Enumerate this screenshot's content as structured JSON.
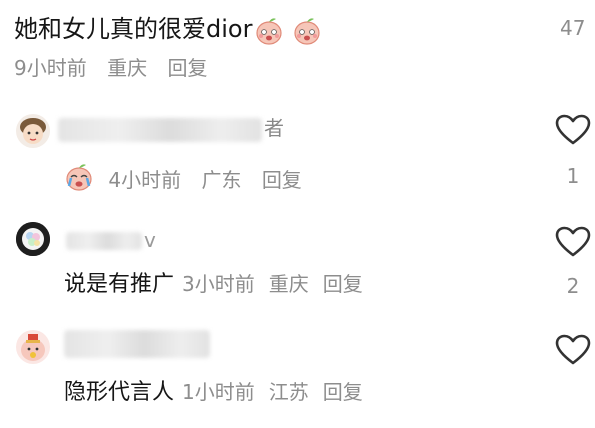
{
  "top_comment": {
    "text": "她和女儿真的很爱dior",
    "emoji": "peach-face-emoji",
    "time": "9小时前",
    "location": "重庆",
    "reply_label": "回复",
    "likes": "47"
  },
  "comments": [
    {
      "username_visible": "者",
      "reply": {
        "emoji": "crying-face-emoji",
        "time": "4小时前",
        "location": "广东",
        "reply_label": "回复"
      },
      "likes": "1"
    },
    {
      "username_visible": "v",
      "text": "说是有推广",
      "time": "3小时前",
      "location": "重庆",
      "reply_label": "回复",
      "likes": "2"
    },
    {
      "text": "隐形代言人",
      "time": "1小时前",
      "location": "江苏",
      "reply_label": "回复"
    }
  ],
  "colors": {
    "text": "#161616",
    "meta": "#8d8d8d",
    "heart": "#333333"
  },
  "icons": [
    "heart-outline-icon",
    "peach-face-emoji",
    "crying-face-emoji"
  ]
}
